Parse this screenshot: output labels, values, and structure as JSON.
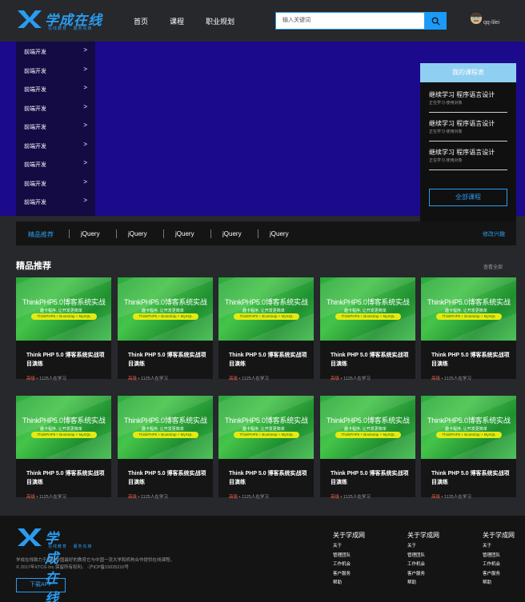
{
  "header": {
    "logo_text": "学成在线",
    "logo_sub": "在线教育 · 服务先锋",
    "nav": [
      "首页",
      "课程",
      "职业规划"
    ],
    "search_placeholder": "输入关键词",
    "username": "qq-lilei"
  },
  "side_menu": {
    "items": [
      "前端开发",
      "前端开发",
      "前端开发",
      "前端开发",
      "前端开发",
      "前端开发",
      "前端开发",
      "前端开发",
      "前端开发"
    ],
    "arrow": ">"
  },
  "course_panel": {
    "title": "我的课程表",
    "items": [
      {
        "title": "继续学习 程序语言设计",
        "sub": "正在学习-使用对象"
      },
      {
        "title": "继续学习 程序语言设计",
        "sub": "正在学习-使用对象"
      },
      {
        "title": "继续学习 程序语言设计",
        "sub": "正在学习-使用对象"
      }
    ],
    "all_button": "全部课程"
  },
  "tabs": {
    "items": [
      "精品推荐",
      "jQuery",
      "jQuery",
      "jQuery",
      "jQuery",
      "jQuery"
    ],
    "more": "修改兴趣"
  },
  "section": {
    "title": "精品推荐",
    "view_all": "查看全部"
  },
  "cards": [
    {
      "thumb_title": "ThinkPHP5.0博客系统实战",
      "thumb_sub": "趣卡程序, 让开发更简单",
      "thumb_pill": "ThinkPHP5 + Bootstrap + MySQL",
      "title": "Think PHP 5.0 博客系统实战项目演练",
      "level": "高级",
      "meta": " • 1125人在学习"
    },
    {
      "thumb_title": "ThinkPHP5.0博客系统实战",
      "thumb_sub": "趣卡程序, 让开发更简单",
      "thumb_pill": "ThinkPHP5 + Bootstrap + MySQL",
      "title": "Think PHP 5.0 博客系统实战项目演练",
      "level": "高级",
      "meta": " • 1125人在学习"
    },
    {
      "thumb_title": "ThinkPHP5.0博客系统实战",
      "thumb_sub": "趣卡程序, 让开发更简单",
      "thumb_pill": "ThinkPHP5 + Bootstrap + MySQL",
      "title": "Think PHP 5.0 博客系统实战项目演练",
      "level": "高级",
      "meta": " • 1125人在学习"
    },
    {
      "thumb_title": "ThinkPHP5.0博客系统实战",
      "thumb_sub": "趣卡程序, 让开发更简单",
      "thumb_pill": "ThinkPHP5 + Bootstrap + MySQL",
      "title": "Think PHP 5.0 博客系统实战项目演练",
      "level": "高级",
      "meta": " • 1125人在学习"
    },
    {
      "thumb_title": "ThinkPHP5.0博客系统实战",
      "thumb_sub": "趣卡程序, 让开发更简单",
      "thumb_pill": "ThinkPHP5 + Bootstrap + MySQL",
      "title": "Think PHP 5.0 博客系统实战项目演练",
      "level": "高级",
      "meta": " • 1125人在学习"
    },
    {
      "thumb_title": "ThinkPHP5.0博客系统实战",
      "thumb_sub": "趣卡程序, 让开发更简单",
      "thumb_pill": "ThinkPHP5 + Bootstrap + MySQL",
      "title": "Think PHP 5.0 博客系统实战项目演练",
      "level": "高级",
      "meta": " • 1125人在学习"
    },
    {
      "thumb_title": "ThinkPHP5.0博客系统实战",
      "thumb_sub": "趣卡程序, 让开发更简单",
      "thumb_pill": "ThinkPHP5 + Bootstrap + MySQL",
      "title": "Think PHP 5.0 博客系统实战项目演练",
      "level": "高级",
      "meta": " • 1125人在学习"
    },
    {
      "thumb_title": "ThinkPHP5.0博客系统实战",
      "thumb_sub": "趣卡程序, 让开发更简单",
      "thumb_pill": "ThinkPHP5 + Bootstrap + MySQL",
      "title": "Think PHP 5.0 博客系统实战项目演练",
      "level": "高级",
      "meta": " • 1125人在学习"
    },
    {
      "thumb_title": "ThinkPHP5.0博客系统实战",
      "thumb_sub": "趣卡程序, 让开发更简单",
      "thumb_pill": "ThinkPHP5 + Bootstrap + MySQL",
      "title": "Think PHP 5.0 博客系统实战项目演练",
      "level": "高级",
      "meta": " • 1125人在学习"
    },
    {
      "thumb_title": "ThinkPHP5.0博客系统实战",
      "thumb_sub": "趣卡程序, 让开发更简单",
      "thumb_pill": "ThinkPHP5 + Bootstrap + MySQL",
      "title": "Think PHP 5.0 博客系统实战项目演练",
      "level": "高级",
      "meta": " • 1125人在学习"
    }
  ],
  "footer": {
    "logo_text": "学成在线",
    "logo_sub": "在线教育 · 服务先锋",
    "desc_line1": "学成在线致力于普及中国最好的教育它与中国一流大学和机构合作提供在线课程。",
    "desc_line2": "© 2017年XTCG Inc.保留所有权利。 -沪ICP备15025210号",
    "download_button": "下载APP",
    "columns": [
      {
        "heading": "关于学成网",
        "links": [
          "关于",
          "管理团队",
          "工作机会",
          "客户服务",
          "帮助"
        ]
      },
      {
        "heading": "关于学成网",
        "links": [
          "关于",
          "管理团队",
          "工作机会",
          "客户服务",
          "帮助"
        ]
      },
      {
        "heading": "关于学成网",
        "links": [
          "关于",
          "管理团队",
          "工作机会",
          "客户服务",
          "帮助"
        ]
      }
    ]
  },
  "colors": {
    "accent": "#2a9cf0",
    "banner_bg": "#1c0a8c",
    "side_menu_bg": "#140a44",
    "page_bg": "#26282b",
    "level_red": "#f7614a",
    "panel_header": "#8fcff2"
  },
  "icons": {
    "search": "search-icon",
    "logo": "xc-logo-icon",
    "avatar": "avatar"
  }
}
